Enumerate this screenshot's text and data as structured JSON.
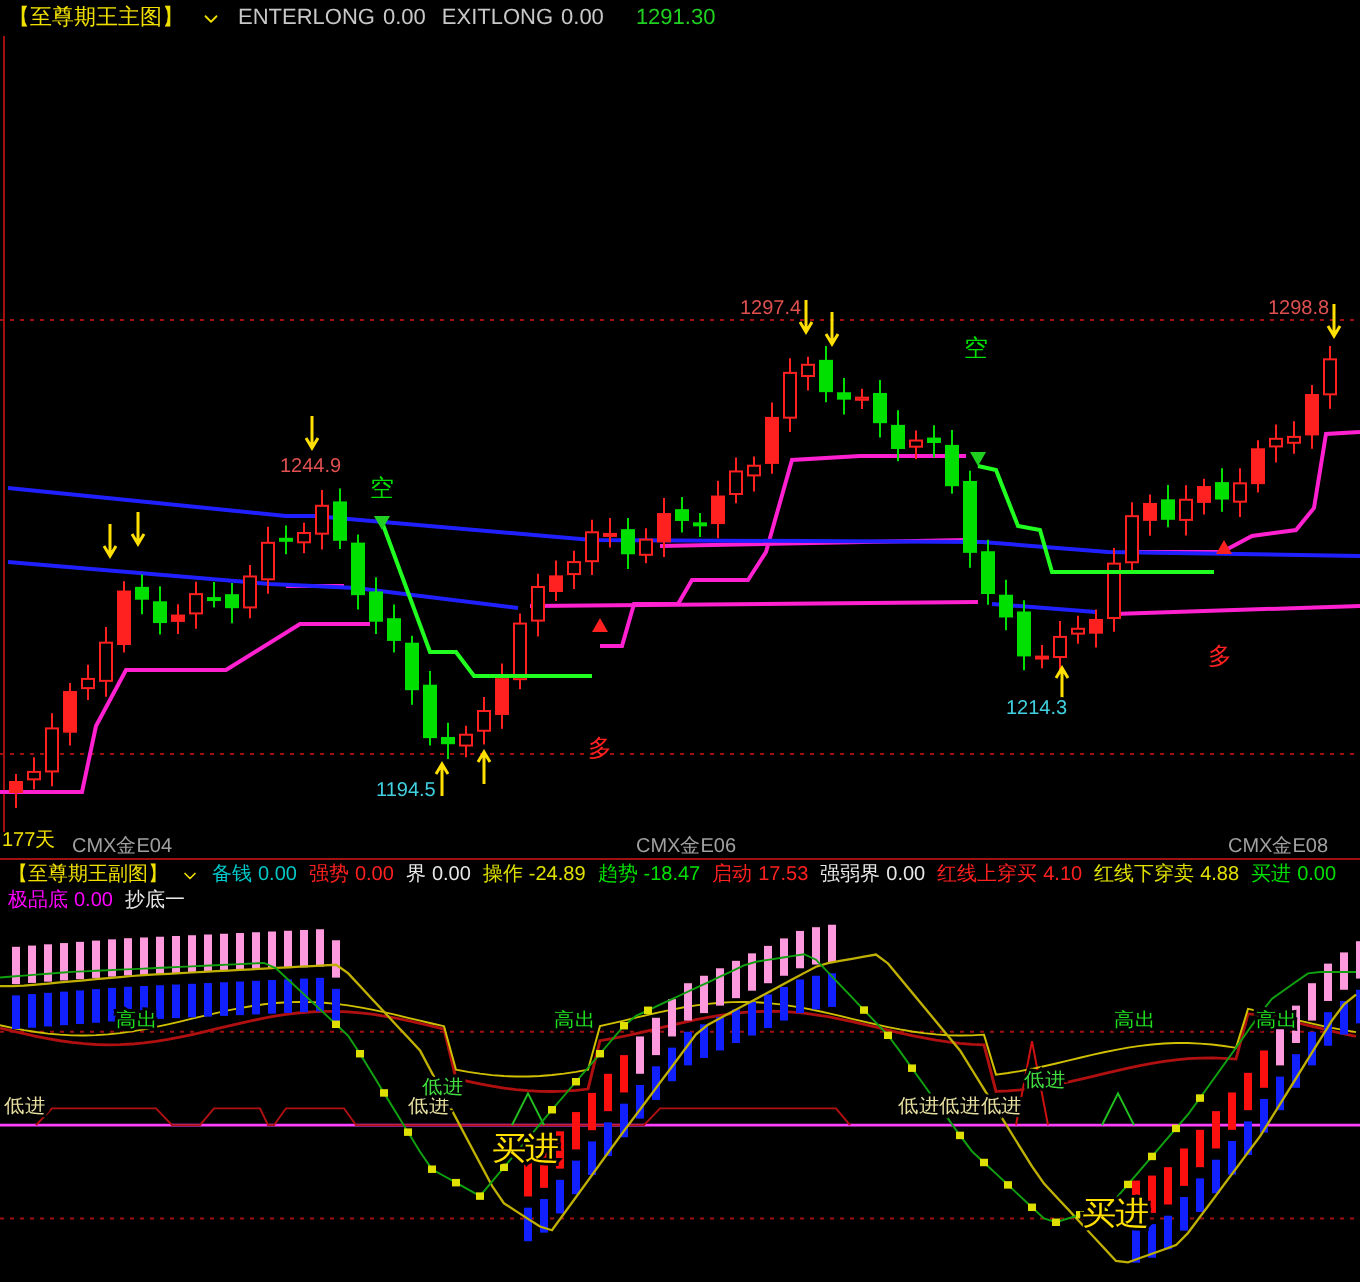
{
  "main_panel": {
    "title": "【至尊期王主图】",
    "readouts": [
      {
        "label": "ENTERLONG",
        "value": "0.00"
      },
      {
        "label": "EXITLONG",
        "value": "0.00"
      }
    ],
    "last_price": "1291.30",
    "price_labels": [
      "1244.9",
      "1297.4",
      "1298.8",
      "1214.3",
      "1194.5"
    ],
    "signals": [
      {
        "kind": "short",
        "text": "空"
      },
      {
        "kind": "short",
        "text": "空"
      },
      {
        "kind": "long",
        "text": "多"
      },
      {
        "kind": "long",
        "text": "多"
      }
    ]
  },
  "time_axis": {
    "bars_label": "177天",
    "contracts": [
      "CMX金E04",
      "CMX金E06",
      "CMX金E08"
    ]
  },
  "sub_panel": {
    "title": "【至尊期王副图】",
    "readouts": [
      {
        "label": "备钱",
        "value": "0.00",
        "color": "#00c8c8"
      },
      {
        "label": "强势",
        "value": "0.00",
        "color": "#ff2020"
      },
      {
        "label": "界",
        "value": "0.00",
        "color": "#e8e8e8"
      },
      {
        "label": "操作",
        "value": "-24.89",
        "color": "#e0e000"
      },
      {
        "label": "趋势",
        "value": "-18.47",
        "color": "#00e000"
      },
      {
        "label": "启动",
        "value": "17.53",
        "color": "#ff2020"
      },
      {
        "label": "强弱界",
        "value": "0.00",
        "color": "#e8e8e8"
      },
      {
        "label": "红线上穿买",
        "value": "4.10",
        "color": "#ff2020"
      },
      {
        "label": "红线下穿卖",
        "value": "4.88",
        "color": "#e0e000"
      },
      {
        "label": "买进",
        "value": "0.00",
        "color": "#00e000"
      },
      {
        "label": "极品底",
        "value": "0.00",
        "color": "#ff00ff"
      },
      {
        "label": "抄底一",
        "color": "#e8e8e8"
      }
    ],
    "signals": [
      {
        "kind": "high",
        "text": "高出"
      },
      {
        "kind": "high",
        "text": "高出"
      },
      {
        "kind": "high",
        "text": "高出"
      },
      {
        "kind": "high",
        "text": "高出"
      },
      {
        "kind": "low",
        "text": "低进"
      },
      {
        "kind": "low",
        "text": "低进"
      },
      {
        "kind": "cross",
        "text": "低进"
      },
      {
        "kind": "low",
        "text": "低进低进低进"
      },
      {
        "kind": "cross",
        "text": "低进"
      },
      {
        "kind": "buy",
        "text": "买进"
      },
      {
        "kind": "buy",
        "text": "买进"
      }
    ]
  }
}
